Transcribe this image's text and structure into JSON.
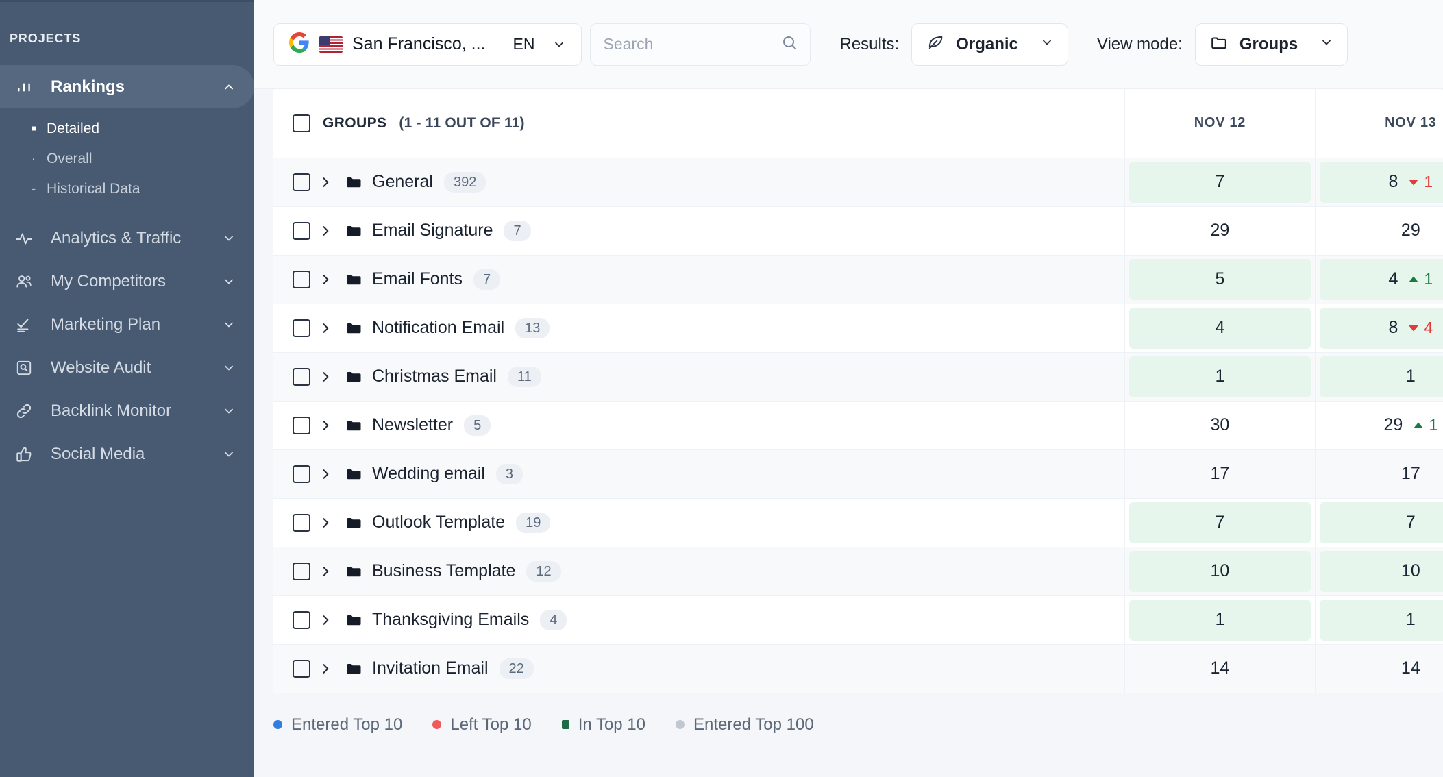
{
  "sidebar": {
    "section_label": "PROJECTS",
    "items": [
      {
        "label": "Rankings",
        "icon": "bar-chart-icon",
        "active": true,
        "expanded": true,
        "sub": [
          {
            "label": "Detailed",
            "selected": true
          },
          {
            "label": "Overall",
            "selected": false
          },
          {
            "label": "Historical Data",
            "selected": false
          }
        ]
      },
      {
        "label": "Analytics & Traffic",
        "icon": "pulse-icon",
        "active": false,
        "expanded": false,
        "sub": []
      },
      {
        "label": "My Competitors",
        "icon": "people-icon",
        "active": false,
        "expanded": false,
        "sub": []
      },
      {
        "label": "Marketing Plan",
        "icon": "checklist-icon",
        "active": false,
        "expanded": false,
        "sub": []
      },
      {
        "label": "Website Audit",
        "icon": "magnifier-box-icon",
        "active": false,
        "expanded": false,
        "sub": []
      },
      {
        "label": "Backlink Monitor",
        "icon": "link-icon",
        "active": false,
        "expanded": false,
        "sub": []
      },
      {
        "label": "Social Media",
        "icon": "thumbs-up-icon",
        "active": false,
        "expanded": false,
        "sub": []
      }
    ]
  },
  "toolbar": {
    "engine": {
      "icon": "google-icon",
      "flag": "us-flag-icon",
      "location": "San Francisco, ...",
      "language": "EN"
    },
    "search": {
      "placeholder": "Search",
      "value": "",
      "icon": "search-icon"
    },
    "results_label": "Results:",
    "results_value": "Organic",
    "results_icon": "leaf-icon",
    "viewmode_label": "View mode:",
    "viewmode_value": "Groups",
    "viewmode_icon": "folder-icon"
  },
  "table": {
    "header": {
      "groups_label": "GROUPS",
      "count_label": "(1 - 11 OUT OF 11)",
      "select_all_checked": false
    },
    "date_columns": [
      "NOV 12",
      "NOV 13",
      ""
    ],
    "rows": [
      {
        "name": "General",
        "count": "392",
        "cells": [
          {
            "value": "7",
            "hl": true,
            "delta": null
          },
          {
            "value": "8",
            "hl": true,
            "delta": {
              "dir": "down",
              "num": "1"
            }
          },
          {
            "value": "",
            "hl": false,
            "delta": null
          }
        ]
      },
      {
        "name": "Email Signature",
        "count": "7",
        "cells": [
          {
            "value": "29",
            "hl": false,
            "delta": null
          },
          {
            "value": "29",
            "hl": false,
            "delta": null
          },
          {
            "value": "",
            "hl": true,
            "delta": null
          }
        ]
      },
      {
        "name": "Email Fonts",
        "count": "7",
        "cells": [
          {
            "value": "5",
            "hl": true,
            "delta": null
          },
          {
            "value": "4",
            "hl": true,
            "delta": {
              "dir": "up",
              "num": "1"
            }
          },
          {
            "value": "",
            "hl": false,
            "delta": null
          }
        ]
      },
      {
        "name": "Notification Email",
        "count": "13",
        "cells": [
          {
            "value": "4",
            "hl": true,
            "delta": null
          },
          {
            "value": "8",
            "hl": true,
            "delta": {
              "dir": "down",
              "num": "4"
            }
          },
          {
            "value": "",
            "hl": true,
            "delta": null
          }
        ]
      },
      {
        "name": "Christmas Email",
        "count": "11",
        "cells": [
          {
            "value": "1",
            "hl": true,
            "delta": null
          },
          {
            "value": "1",
            "hl": true,
            "delta": null
          },
          {
            "value": "",
            "hl": true,
            "delta": null
          }
        ]
      },
      {
        "name": "Newsletter",
        "count": "5",
        "cells": [
          {
            "value": "30",
            "hl": false,
            "delta": null
          },
          {
            "value": "29",
            "hl": false,
            "delta": {
              "dir": "up",
              "num": "1"
            }
          },
          {
            "value": "",
            "hl": true,
            "delta": null
          }
        ]
      },
      {
        "name": "Wedding email",
        "count": "3",
        "cells": [
          {
            "value": "17",
            "hl": false,
            "delta": null
          },
          {
            "value": "17",
            "hl": false,
            "delta": null
          },
          {
            "value": "",
            "hl": false,
            "delta": null
          }
        ]
      },
      {
        "name": "Outlook Template",
        "count": "19",
        "cells": [
          {
            "value": "7",
            "hl": true,
            "delta": null
          },
          {
            "value": "7",
            "hl": true,
            "delta": null
          },
          {
            "value": "",
            "hl": true,
            "delta": null
          }
        ]
      },
      {
        "name": "Business Template",
        "count": "12",
        "cells": [
          {
            "value": "10",
            "hl": true,
            "delta": null
          },
          {
            "value": "10",
            "hl": true,
            "delta": null
          },
          {
            "value": "",
            "hl": true,
            "delta": null
          }
        ]
      },
      {
        "name": "Thanksgiving Emails",
        "count": "4",
        "cells": [
          {
            "value": "1",
            "hl": true,
            "delta": null
          },
          {
            "value": "1",
            "hl": true,
            "delta": null
          },
          {
            "value": "",
            "hl": true,
            "delta": null
          }
        ]
      },
      {
        "name": "Invitation Email",
        "count": "22",
        "cells": [
          {
            "value": "14",
            "hl": false,
            "delta": null
          },
          {
            "value": "14",
            "hl": false,
            "delta": null
          },
          {
            "value": "",
            "hl": false,
            "delta": null
          }
        ]
      }
    ]
  },
  "legend": [
    {
      "label": "Entered Top 10",
      "color": "#2f7fe0",
      "shape": "dot"
    },
    {
      "label": "Left Top 10",
      "color": "#f05a5a",
      "shape": "dot"
    },
    {
      "label": "In Top 10",
      "color": "#1f6b47",
      "shape": "sq"
    },
    {
      "label": "Entered Top 100",
      "color": "#c2c8d0",
      "shape": "dot"
    }
  ]
}
